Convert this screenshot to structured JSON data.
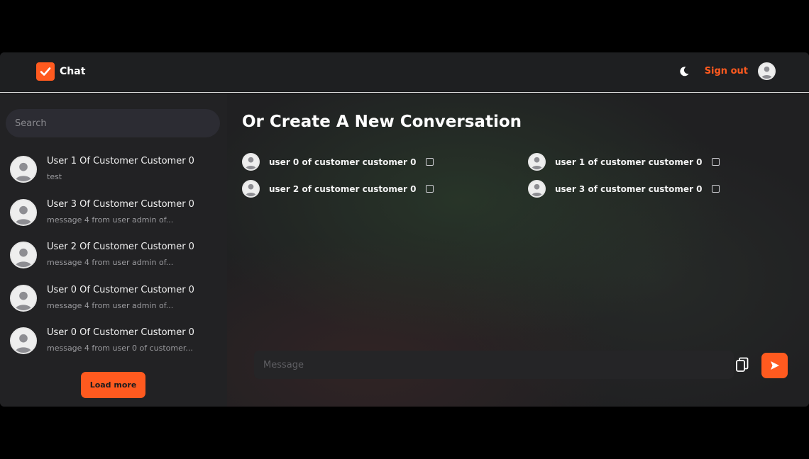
{
  "header": {
    "brand": "Chat",
    "sign_out": "Sign out"
  },
  "sidebar": {
    "search_placeholder": "Search",
    "conversations": [
      {
        "name": "User 1 Of Customer Customer 0",
        "preview": "test"
      },
      {
        "name": "User 3 Of Customer Customer 0",
        "preview": "message 4 from user admin of..."
      },
      {
        "name": "User 2 Of Customer Customer 0",
        "preview": "message 4 from user admin of..."
      },
      {
        "name": "User 0 Of Customer Customer 0",
        "preview": "message 4 from user admin of..."
      },
      {
        "name": "User 0 Of Customer Customer 0",
        "preview": "message 4 from user 0 of customer..."
      }
    ],
    "load_more": "Load more"
  },
  "main": {
    "title": "Or Create A New Conversation",
    "users": [
      {
        "label": "user 0 of customer customer 0"
      },
      {
        "label": "user 1 of customer customer 0"
      },
      {
        "label": "user 2 of customer customer 0"
      },
      {
        "label": "user 3 of customer customer 0"
      }
    ],
    "message_placeholder": "Message"
  },
  "colors": {
    "accent": "#ff5a1f",
    "background": "#1b1b1d"
  },
  "icons": {
    "brand": "check-icon",
    "theme": "moon-icon",
    "avatar": "user-avatar-icon",
    "attach": "attachment-icon",
    "send": "send-icon"
  }
}
